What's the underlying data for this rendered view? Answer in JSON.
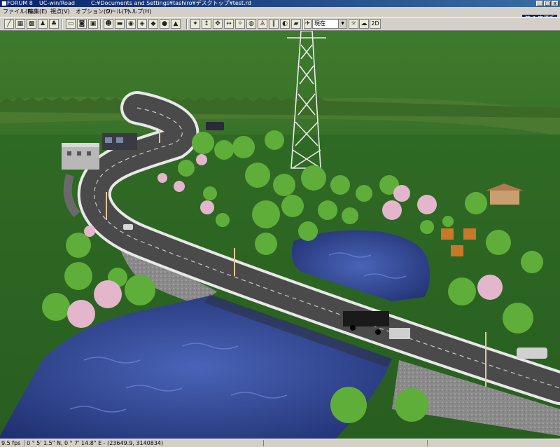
{
  "window": {
    "app_name": "FORUM 8",
    "product": "UC-win/Road",
    "file_path": "C:¥Documents and Settings¥tashiro¥デスクトップ¥test.rd",
    "minimize": "_",
    "maximize": "□",
    "close": "x"
  },
  "menu": {
    "items": [
      "ファイル(F)",
      "編集(E)",
      "視点(V)",
      "オプション(O)",
      "ツール(T)",
      "ヘルプ(H)"
    ],
    "coordinate_system": "第 0 座標系"
  },
  "toolbar": {
    "buttons": [
      "road-icon",
      "grid-icon",
      "map-icon",
      "person-icon",
      "tree-icon",
      "capture-icon",
      "camera-icon",
      "save-icon",
      "people-icon",
      "vehicle-icon",
      "traffic-icon",
      "signal-icon",
      "texture-icon",
      "globe-icon",
      "model-icon",
      "compass-icon",
      "move-icon",
      "rotate-icon",
      "pan-icon",
      "orbit-icon",
      "globe-view-icon",
      "walk-icon",
      "pause-icon",
      "drive-icon",
      "car-icon",
      "plane-icon",
      "time-icon",
      "weather-icon"
    ],
    "time_select": "現在",
    "view_2d": "2D"
  },
  "status": {
    "fps": "9.5 fps",
    "coords": "0 ° 5' 1.5\" N, 0 ° 7' 14.8\" E  -  (23649.9, 3140834)"
  },
  "colors": {
    "title_start": "#0a246a",
    "title_end": "#3a6ea5",
    "chrome": "#d4d0c8",
    "grass": "#2f6a24",
    "water": "#2a3f8a",
    "road": "#4a4a4a"
  }
}
